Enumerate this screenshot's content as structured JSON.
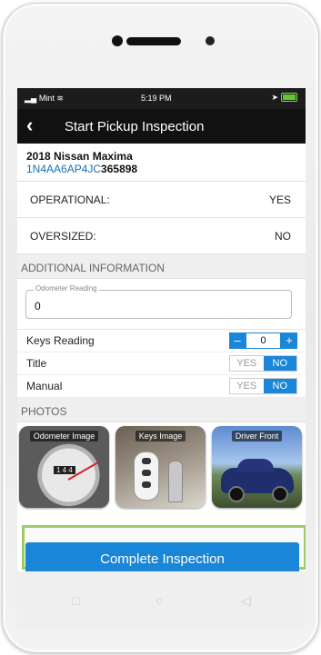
{
  "status_bar": {
    "carrier": "Mint",
    "time": "5:19 PM"
  },
  "app_bar": {
    "back_icon": "chevron-left",
    "title": "Start Pickup Inspection"
  },
  "vehicle": {
    "name": "2018 Nissan Maxima",
    "vin_prefix": "1N4AA6AP4JC",
    "vin_suffix": "365898"
  },
  "info_rows": [
    {
      "label": "OPERATIONAL:",
      "value": "YES"
    },
    {
      "label": "OVERSIZED:",
      "value": "NO"
    }
  ],
  "additional_info": {
    "header": "ADDITIONAL INFORMATION",
    "odometer": {
      "legend": "Odometer Reading",
      "value": "0"
    },
    "keys": {
      "label": "Keys Reading",
      "minus": "–",
      "value": "0",
      "plus": "+"
    },
    "title": {
      "label": "Title",
      "yes": "YES",
      "no": "NO",
      "selected": "NO"
    },
    "manual": {
      "label": "Manual",
      "yes": "YES",
      "no": "NO",
      "selected": "NO"
    }
  },
  "photos": {
    "header": "PHOTOS",
    "items": [
      {
        "caption": "Odometer Image",
        "gauge_readout": "1 4 4"
      },
      {
        "caption": "Keys Image"
      },
      {
        "caption": "Driver Front"
      }
    ]
  },
  "cta": {
    "label": "Complete Inspection",
    "outline_color": "#9ecb6a",
    "button_color": "#1a86d8"
  },
  "nav": {
    "icons": [
      "square-icon",
      "circle-icon",
      "triangle-left-icon"
    ]
  }
}
